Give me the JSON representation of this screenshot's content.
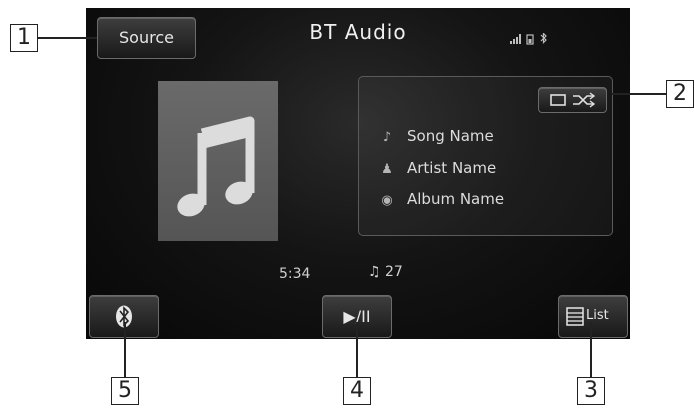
{
  "header": {
    "source_label": "Source",
    "title": "BT Audio",
    "status_text": "..‖ ▤ ✱"
  },
  "album_art": {
    "icon": "music-note-icon",
    "glyph": "♫"
  },
  "track_info": {
    "shuffle_glyph": "▭ ⤨",
    "song": {
      "icon": "note-icon",
      "glyph": "♪",
      "label": "Song Name"
    },
    "artist": {
      "icon": "artist-icon",
      "glyph": "♟",
      "label": "Artist Name"
    },
    "album": {
      "icon": "disc-icon",
      "glyph": "◉",
      "label": "Album Name"
    }
  },
  "playback": {
    "time": "5:34",
    "track_glyph": "♫",
    "track_number": "27"
  },
  "controls": {
    "bluetooth_glyph": "✱",
    "play_pause_label": "▶/II",
    "list_label": "List"
  },
  "callouts": {
    "c1": "1",
    "c2": "2",
    "c3": "3",
    "c4": "4",
    "c5": "5"
  }
}
